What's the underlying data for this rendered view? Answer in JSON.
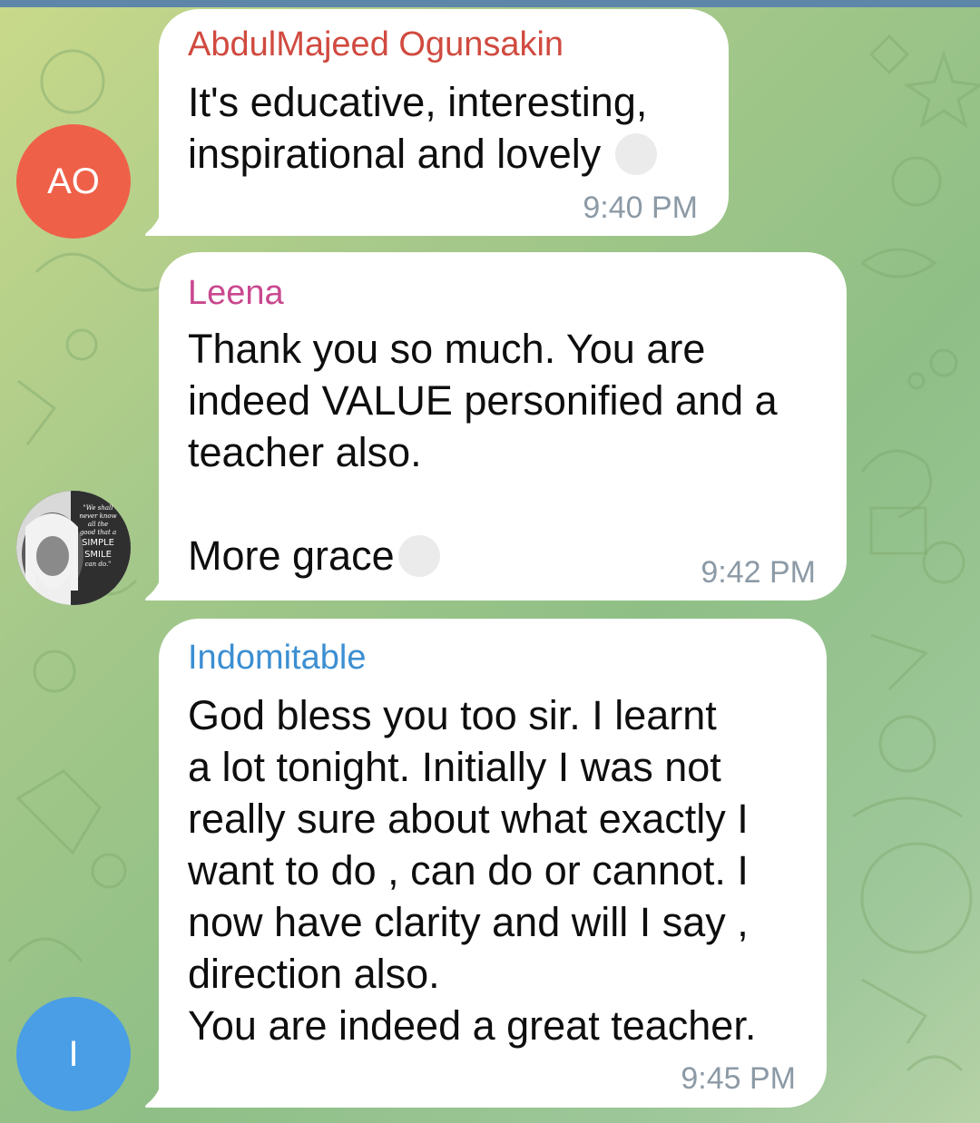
{
  "chat": {
    "messages": [
      {
        "sender": "AbdulMajeed Ogunsakin",
        "sender_color": "#d04a3f",
        "avatar_initials": "AO",
        "avatar_color": "#ef6049",
        "text": "It's educative, interesting,\ninspirational and lovely",
        "time": "9:40 PM"
      },
      {
        "sender": "Leena",
        "sender_color": "#c9488f",
        "avatar_quote_lines": [
          "\"We shall",
          "never know",
          "all the",
          "good that a",
          "SIMPLE",
          "SMILE",
          "can do.\""
        ],
        "text_main": "Thank you so much. You are\nindeed VALUE personified and a\nteacher also.",
        "text_last": "More grace",
        "time": "9:42 PM"
      },
      {
        "sender": "Indomitable",
        "sender_color": "#3c8fd2",
        "avatar_initials": "I",
        "avatar_color": "#4a9ee6",
        "text": "God bless you too sir. I learnt\na lot tonight. Initially I was not\nreally sure about what exactly I\nwant to do , can do or cannot. I\nnow have clarity and will I say ,\ndirection also.\nYou are indeed a great teacher.",
        "time": "9:45 PM"
      }
    ]
  }
}
